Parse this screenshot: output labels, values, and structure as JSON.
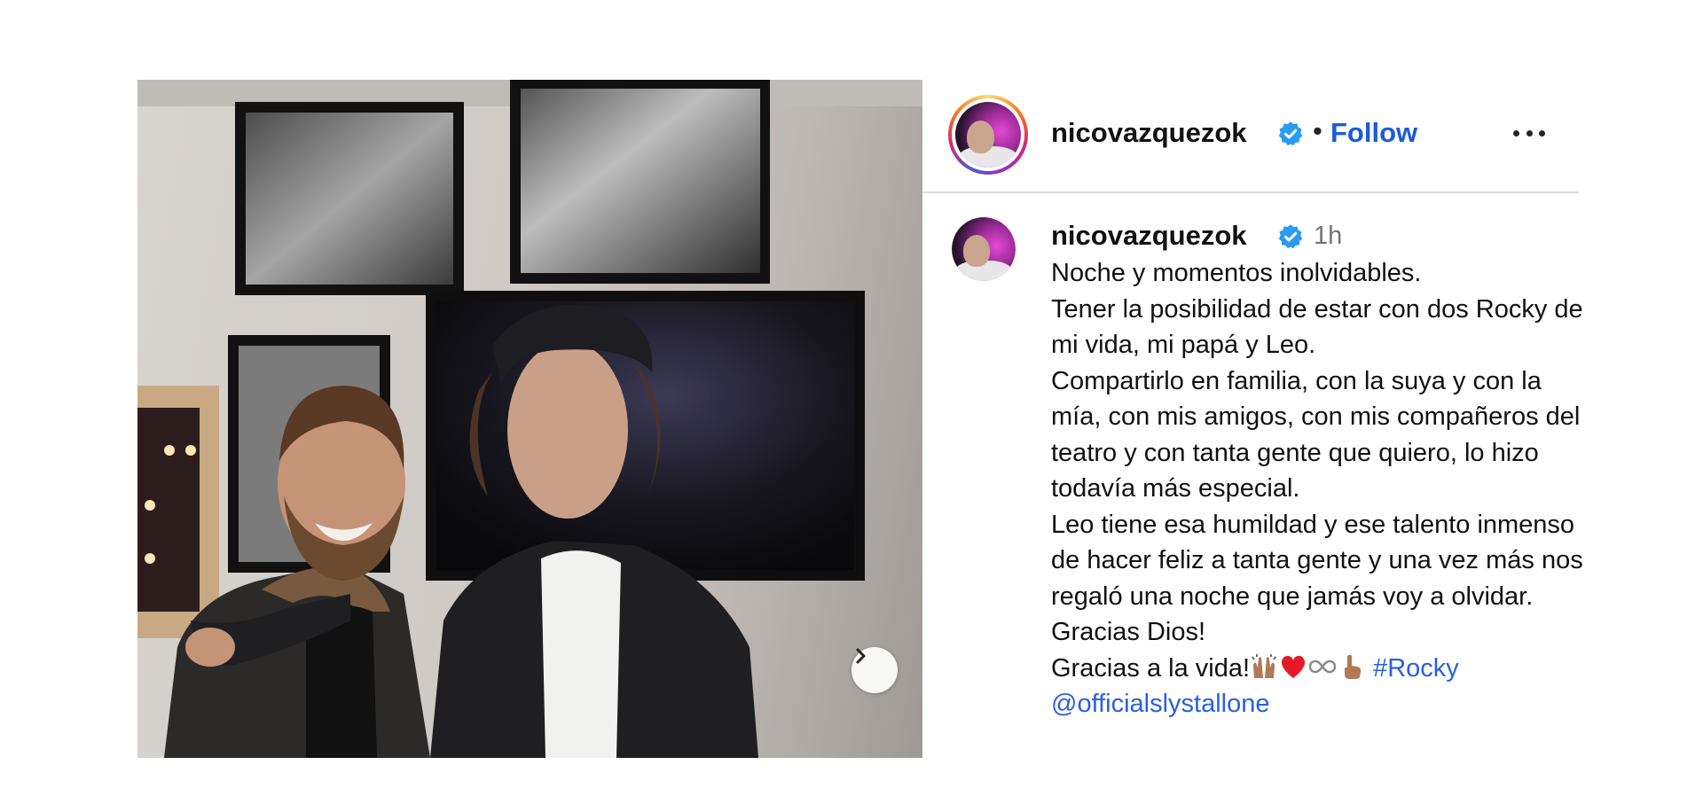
{
  "header": {
    "username": "nicovazquezok",
    "separator": "•",
    "follow_label": "Follow",
    "more_icon": "more-horizontal-icon",
    "verified_icon": "verified-badge-icon"
  },
  "caption": {
    "username": "nicovazquezok",
    "timestamp": "1h",
    "text": "Noche y momentos inolvidables.\nTener la posibilidad de estar con dos Rocky de mi vida, mi papá y Leo.\nCompartirlo en familia, con la suya y con la mía, con mis amigos, con mis compañeros del teatro y con tanta gente que quiero, lo hizo todavía más especial.\nLeo tiene esa humildad y ese talento inmenso de hacer feliz a tanta gente y una vez más nos regaló una noche que jamás voy a olvidar.  Gracias Dios!\nGracias a la vida!",
    "emojis": [
      "raised-hands-emoji",
      "red-heart-emoji",
      "infinity-emoji",
      "pointing-up-emoji"
    ],
    "hashtag": "#Rocky",
    "mention": "@officialslystallone"
  },
  "carousel": {
    "next_icon": "chevron-right-icon"
  },
  "colors": {
    "follow": "#1a5bd9",
    "link": "#2b5fe0",
    "verified": "#2a9af3",
    "timestamp": "#737373",
    "divider": "#dbdbdb"
  }
}
